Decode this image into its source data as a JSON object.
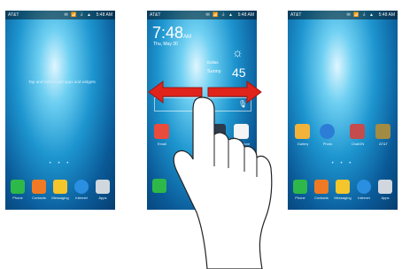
{
  "status": {
    "carrier": "AT&T",
    "icons": "✉ 📶 ⏚ ▲",
    "time": "5:48 AM"
  },
  "screen1": {
    "hint": "Tap and hold to add apps and widgets",
    "dock": [
      {
        "label": "Phone",
        "icon": "phone-icon",
        "color": "#2eb84a"
      },
      {
        "label": "Contacts",
        "icon": "contacts-icon",
        "color": "#f07a24"
      },
      {
        "label": "Messaging",
        "icon": "messaging-icon",
        "color": "#f5c52c"
      },
      {
        "label": "Internet",
        "icon": "internet-icon",
        "color": "#2a8fe0"
      },
      {
        "label": "Apps",
        "icon": "apps-grid-icon",
        "color": "#d0d7de"
      }
    ]
  },
  "screen2": {
    "clock": "7:48",
    "ampm": "AM",
    "date": "Thu, May 30",
    "city": "Dallas",
    "condition": "Sunny",
    "temp": "45",
    "apps": [
      {
        "label": "Email",
        "icon": "email-icon"
      },
      {
        "label": "Camera",
        "icon": "camera-icon"
      },
      {
        "label": "Play Store",
        "icon": "play-store-icon"
      }
    ]
  },
  "screen3": {
    "apps": [
      {
        "label": "Gallery",
        "icon": "gallery-icon",
        "color": "#f3b33a"
      },
      {
        "label": "Photo",
        "icon": "photo-icon",
        "color": "#2b7dd6"
      },
      {
        "label": "ChatON",
        "icon": "chaton-icon",
        "color": "#c44c4c"
      },
      {
        "label": "AT&T",
        "icon": "att-icon",
        "color": "#a28b43"
      }
    ],
    "dock": [
      {
        "label": "Phone",
        "icon": "phone-icon",
        "color": "#2eb84a"
      },
      {
        "label": "Contacts",
        "icon": "contacts-icon",
        "color": "#f07a24"
      },
      {
        "label": "Messaging",
        "icon": "messaging-icon",
        "color": "#f5c52c"
      },
      {
        "label": "Internet",
        "icon": "internet-icon",
        "color": "#2a8fe0"
      },
      {
        "label": "Apps",
        "icon": "apps-grid-icon",
        "color": "#d0d7de"
      }
    ]
  },
  "swipe": {
    "arrow_color": "#e0241c"
  }
}
